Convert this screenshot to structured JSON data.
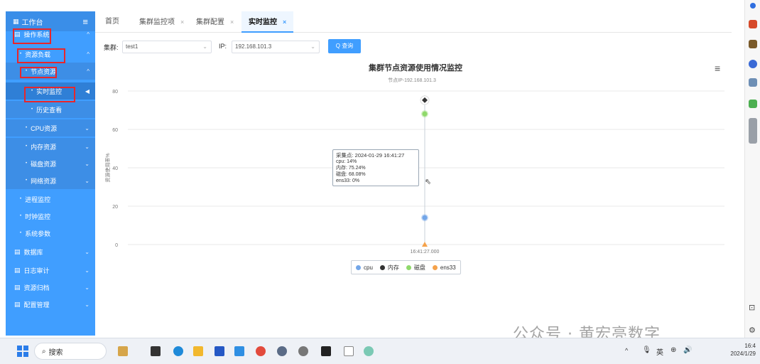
{
  "sidebar": {
    "header": "工作台",
    "items": [
      {
        "label": "操作系统",
        "level": 0,
        "expanded": true
      },
      {
        "label": "资源负载",
        "level": 1,
        "expanded": true
      },
      {
        "label": "节点资源",
        "level": 2,
        "expanded": true
      },
      {
        "label": "实时监控",
        "level": 3,
        "active": true
      },
      {
        "label": "历史查看",
        "level": 3
      },
      {
        "label": "CPU资源",
        "level": 2
      },
      {
        "label": "内存资源",
        "level": 2
      },
      {
        "label": "磁盘资源",
        "level": 2
      },
      {
        "label": "网络资源",
        "level": 2
      },
      {
        "label": "进程监控",
        "level": 1
      },
      {
        "label": "时钟监控",
        "level": 1
      },
      {
        "label": "系统参数",
        "level": 1
      },
      {
        "label": "数据库",
        "level": 0
      },
      {
        "label": "日志审计",
        "level": 0
      },
      {
        "label": "资源归档",
        "level": 0
      },
      {
        "label": "配置管理",
        "level": 0
      }
    ]
  },
  "tabs": [
    {
      "label": "首页",
      "closable": false
    },
    {
      "label": "集群监控项",
      "closable": true
    },
    {
      "label": "集群配置",
      "closable": true
    },
    {
      "label": "实时监控",
      "closable": true,
      "active": true
    }
  ],
  "filter": {
    "cluster_label": "集群:",
    "cluster_value": "test1",
    "ip_label": "IP:",
    "ip_value": "192.168.101.3",
    "query_label": "Q 查询"
  },
  "chart_data": {
    "type": "scatter",
    "title": "集群节点资源使用情况监控",
    "subtitle": "节点IP-192.168.101.3",
    "ylabel": "资源使用率%",
    "ylim": [
      0,
      80
    ],
    "yticks": [
      0,
      20,
      40,
      60,
      80
    ],
    "x": [
      "16:41:27.000"
    ],
    "series": [
      {
        "name": "cpu",
        "color": "#73a6e8",
        "values": [
          14
        ]
      },
      {
        "name": "内存",
        "color": "#333333",
        "values": [
          75.24
        ]
      },
      {
        "name": "磁盘",
        "color": "#8fd96b",
        "values": [
          68.08
        ]
      },
      {
        "name": "ens33",
        "color": "#f5a24b",
        "values": [
          0
        ]
      }
    ],
    "tooltip": {
      "title": "采集点: 2024-01-29 16:41:27",
      "lines": [
        "cpu: 14%",
        "内存: 75.24%",
        "磁盘: 68.08%",
        "ens33: 0%"
      ]
    },
    "grid": true,
    "legend_position": "bottom-center"
  },
  "taskbar": {
    "search_placeholder": "搜索",
    "tray_lang": "英",
    "clock_time": "16:4",
    "clock_date": "2024/1/29"
  },
  "watermark": "公众号 · 黄宏亮数字",
  "colors": {
    "sidebar": "#409eff",
    "accent": "#409eff",
    "annotation": "#e8262b"
  }
}
